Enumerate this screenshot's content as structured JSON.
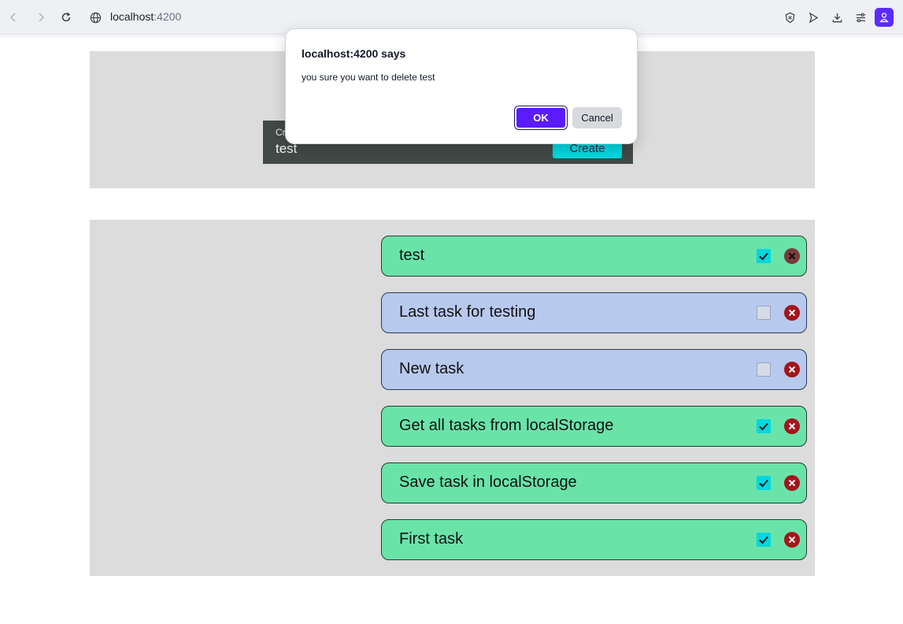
{
  "browser": {
    "url_host": "localhost",
    "url_port": ":4200"
  },
  "create_form": {
    "caption": "Cr",
    "input_value": "test",
    "button_label": "Create"
  },
  "tasks": [
    {
      "label": "test",
      "completed": true
    },
    {
      "label": "Last task for testing",
      "completed": false
    },
    {
      "label": "New task",
      "completed": false
    },
    {
      "label": "Get all tasks from localStorage",
      "completed": true
    },
    {
      "label": "Save task in localStorage",
      "completed": true
    },
    {
      "label": "First task",
      "completed": true
    }
  ],
  "dialog": {
    "title": "localhost:4200 says",
    "message": "you sure you want to delete test",
    "ok_label": "OK",
    "cancel_label": "Cancel"
  },
  "colors": {
    "task_done": "#6ae3a9",
    "task_open": "#b8c9ee",
    "accent_cyan": "#00d8df",
    "delete_red": "#a3161b",
    "dialog_ok": "#5a1cff"
  }
}
